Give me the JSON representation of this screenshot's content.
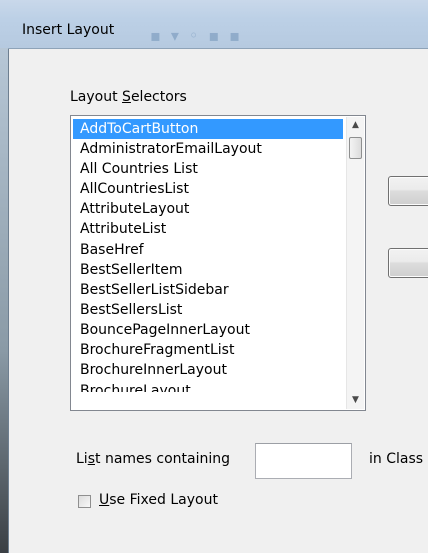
{
  "window": {
    "title": "Insert Layout"
  },
  "layout_selectors": {
    "label_pre": "Layout ",
    "label_ul": "S",
    "label_post": "electors",
    "items": [
      "AddToCartButton",
      "AdministratorEmailLayout",
      "All Countries List",
      "AllCountriesList",
      "AttributeLayout",
      "AttributeList",
      "BaseHref",
      "BestSellerItem",
      "BestSellerListSidebar",
      "BestSellersList",
      "BouncePageInnerLayout",
      "BrochureFragmentList",
      "BrochureInnerLayout",
      "BrochureLayout"
    ],
    "selected_item": "AddToCartButton"
  },
  "filter": {
    "label_pre": "Li",
    "label_ul": "s",
    "label_post": "t names containing",
    "value": "",
    "in_class_label": "in Class"
  },
  "fixed_layout": {
    "label_ul": "U",
    "label_post": "se Fixed Layout",
    "checked": false
  },
  "icons": {
    "scroll_up": "scroll-up-icon",
    "scroll_down": "scroll-down-icon"
  }
}
